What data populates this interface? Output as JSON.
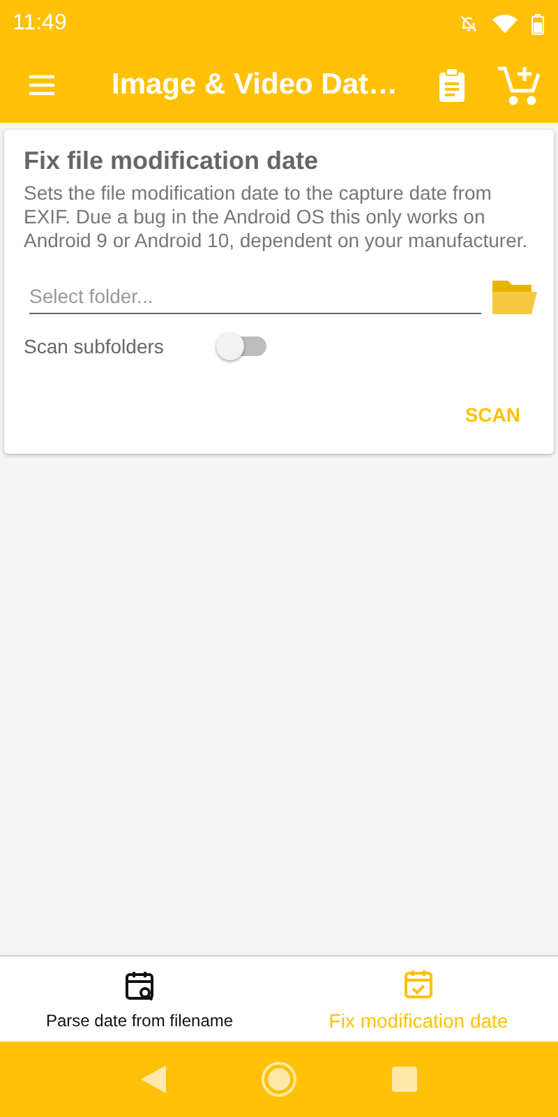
{
  "status_bar": {
    "time": "11:49"
  },
  "toolbar": {
    "title": "Image & Video Dat…"
  },
  "card": {
    "title": "Fix file modification date",
    "description": "Sets the file modification date to the capture date from EXIF. Due a bug in the Android OS this only works on Android 9 or Android 10, dependent on your manufacturer.",
    "folder_field": {
      "placeholder": "Select folder..."
    },
    "subfolders": {
      "label": "Scan subfolders",
      "on": false
    },
    "action": "SCAN"
  },
  "bottom_nav": [
    {
      "label": "Parse date from filename",
      "kind": "search",
      "selected": false
    },
    {
      "label": "Fix modification date",
      "kind": "check",
      "selected": true
    }
  ]
}
